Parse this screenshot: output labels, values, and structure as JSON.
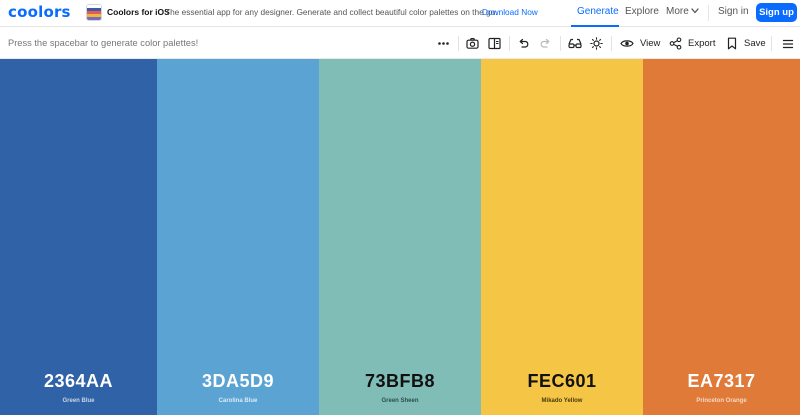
{
  "header": {
    "logo": "coolors",
    "promo": {
      "title": "Coolors for iOS",
      "text": "The essential app for any designer. Generate and collect beautiful color palettes on the go.",
      "link": "Download Now",
      "icon": "palette-app-icon"
    },
    "nav": {
      "generate": "Generate",
      "explore": "Explore",
      "more": "More",
      "signin": "Sign in",
      "signup": "Sign up",
      "active": "Generate"
    },
    "accent": "#0a6cff"
  },
  "toolbar": {
    "hint": "Press the spacebar to generate color palettes!",
    "icons": [
      "more-dots-icon",
      "camera-icon",
      "sidebar-panel-icon",
      "undo-icon",
      "redo-icon",
      "glasses-icon",
      "brightness-icon",
      "eye-icon",
      "share-icon",
      "bookmark-icon",
      "menu-icon"
    ],
    "view_label": "View",
    "export_label": "Export",
    "save_label": "Save"
  },
  "palette": {
    "colors": [
      {
        "hex": "2364AA",
        "name": "Green Blue",
        "bg": "#2F62A6",
        "text": "#ffffff",
        "subtext": "#c9d6ea"
      },
      {
        "hex": "3DA5D9",
        "name": "Carolina Blue",
        "bg": "#5AA3D3",
        "text": "#ffffff",
        "subtext": "#d8ecf7"
      },
      {
        "hex": "73BFB8",
        "name": "Green Sheen",
        "bg": "#80BDB7",
        "text": "#111111",
        "subtext": "#2c4f4b"
      },
      {
        "hex": "FEC601",
        "name": "Mikado Yellow",
        "bg": "#F5C646",
        "text": "#111111",
        "subtext": "#4a3b08"
      },
      {
        "hex": "EA7317",
        "name": "Princeton Orange",
        "bg": "#E07A38",
        "text": "#ffffff",
        "subtext": "#f6d8c3"
      }
    ]
  }
}
